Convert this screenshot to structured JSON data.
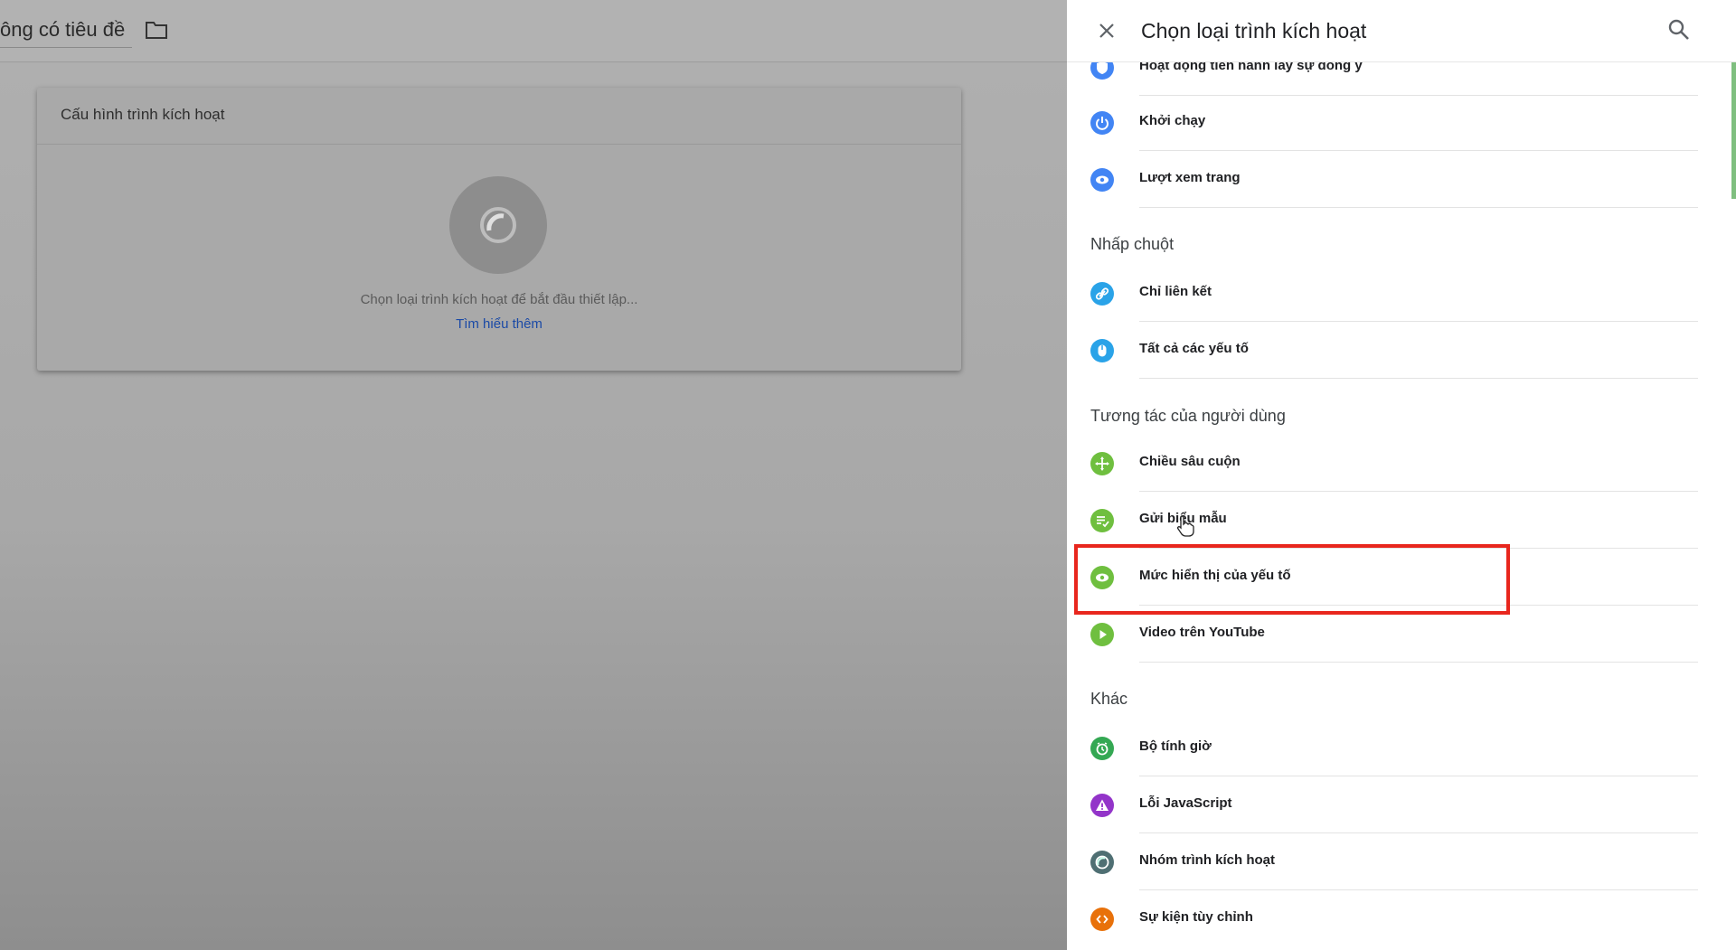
{
  "topbar": {
    "title": "ông có tiêu đề"
  },
  "config_card": {
    "title": "Cấu hình trình kích hoạt",
    "hint": "Chọn loại trình kích hoạt để bắt đầu thiết lập...",
    "learn_more": "Tìm hiểu thêm"
  },
  "drawer": {
    "title": "Chọn loại trình kích hoạt",
    "partial_item": "Hoạt động tiến hành lấy sự đồng ý",
    "page_view_items": [
      "Khởi chạy",
      "Lượt xem trang"
    ],
    "sections": {
      "clicks": {
        "label": "Nhấp chuột",
        "items": [
          "Chỉ liên kết",
          "Tất cả các yếu tố"
        ]
      },
      "user_engagement": {
        "label": "Tương tác của người dùng",
        "items": [
          "Chiều sâu cuộn",
          "Gửi biểu mẫu",
          "Mức hiển thị của yếu tố",
          "Video trên YouTube"
        ]
      },
      "other": {
        "label": "Khác",
        "items": [
          "Bộ tính giờ",
          "Lỗi JavaScript",
          "Nhóm trình kích hoạt",
          "Sự kiện tùy chỉnh"
        ]
      }
    }
  },
  "colors": {
    "blue": "#4285f4",
    "light_blue": "#2aa3e8",
    "green": "#6fbf3f",
    "dark_green": "#34a853",
    "purple": "#9334c9",
    "slate": "#4f6f73",
    "orange": "#e8710a",
    "highlight": "#e8261d"
  }
}
